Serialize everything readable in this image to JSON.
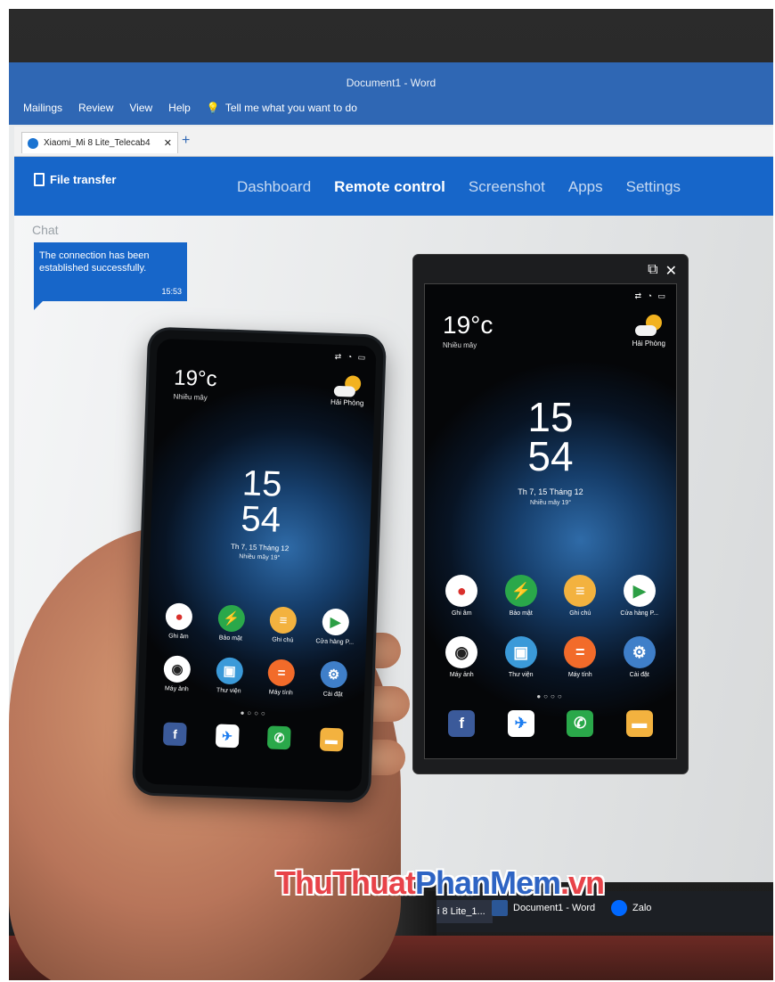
{
  "word": {
    "title": "Document1 - Word",
    "menu": [
      "Mailings",
      "Review",
      "View",
      "Help"
    ],
    "tell_me": "Tell me what you want to do"
  },
  "browser_tab": {
    "title": "Xiaomi_Mi 8 Lite_Telecab4"
  },
  "app": {
    "file_transfer": "File transfer",
    "nav": [
      "Dashboard",
      "Remote control",
      "Screenshot",
      "Apps",
      "Settings"
    ],
    "active_nav": "Remote control"
  },
  "chat": {
    "label": "Chat",
    "message": "The connection has been established successfully.",
    "time": "15:53"
  },
  "phone_screen": {
    "temperature": "19°c",
    "weather_desc": "Nhiều mây",
    "city": "Hải Phòng",
    "hour": "15",
    "minute": "54",
    "date": "Th 7, 15 Tháng 12",
    "subdate": "Nhiều mây 19°",
    "apps": [
      {
        "label": "Ghi âm",
        "icon": "record-icon",
        "color": "#ffffff",
        "glyph": "●",
        "glyph_color": "#d9302c"
      },
      {
        "label": "Bảo mật",
        "icon": "shield-icon",
        "color": "#2aa84a",
        "glyph": "⚡",
        "glyph_color": "#ffffff"
      },
      {
        "label": "Ghi chú",
        "icon": "notes-icon",
        "color": "#f3b23f",
        "glyph": "≡",
        "glyph_color": "#ffffff"
      },
      {
        "label": "Cửa hàng P...",
        "icon": "play-store-icon",
        "color": "#ffffff",
        "glyph": "▶",
        "glyph_color": "#2c9f45"
      },
      {
        "label": "Máy ảnh",
        "icon": "camera-icon",
        "color": "#ffffff",
        "glyph": "◉",
        "glyph_color": "#222222"
      },
      {
        "label": "Thư viện",
        "icon": "gallery-icon",
        "color": "#3b9ad9",
        "glyph": "▣",
        "glyph_color": "#ffffff"
      },
      {
        "label": "Máy tính",
        "icon": "calculator-icon",
        "color": "#f26b2a",
        "glyph": "=",
        "glyph_color": "#ffffff"
      },
      {
        "label": "Cài đặt",
        "icon": "settings-icon",
        "color": "#3f7fc9",
        "glyph": "⚙",
        "glyph_color": "#ffffff"
      }
    ],
    "dock": [
      {
        "icon": "facebook-icon",
        "color": "#3b5a9a",
        "glyph": "f"
      },
      {
        "icon": "messenger-icon",
        "color": "#ffffff",
        "glyph": "✈"
      },
      {
        "icon": "phone-icon",
        "color": "#2aa84a",
        "glyph": "✆"
      },
      {
        "icon": "message-icon",
        "color": "#f3b23f",
        "glyph": "▬"
      }
    ]
  },
  "taskbar": {
    "items": [
      "Xiaomi_Mi 8 Lite_1...",
      "Document1 - Word",
      "Zalo"
    ]
  },
  "watermark": {
    "part1": "ThuThuat",
    "part2": "PhanMem",
    "part3": ".vn"
  }
}
